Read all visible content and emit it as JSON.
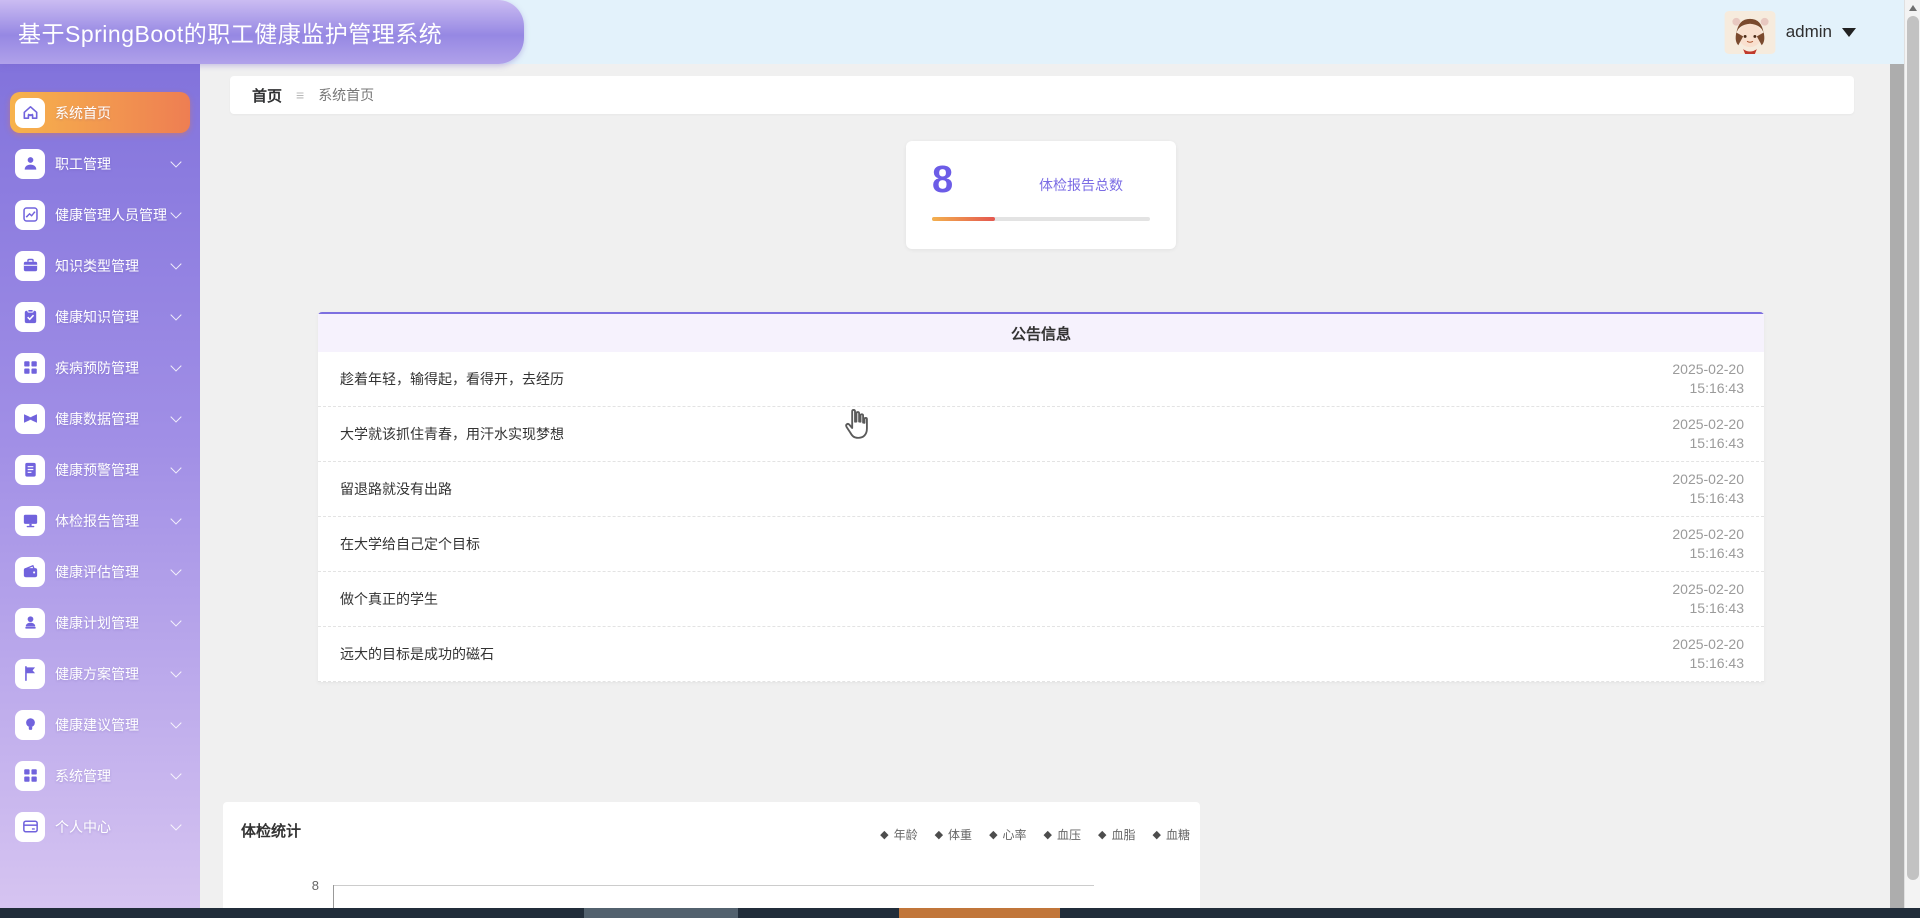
{
  "header": {
    "title": "基于SpringBoot的职工健康监护管理系统",
    "username": "admin"
  },
  "sidebar": {
    "items": [
      {
        "label": "系统首页",
        "icon": "home",
        "active": true
      },
      {
        "label": "职工管理",
        "icon": "worker",
        "active": false
      },
      {
        "label": "健康管理人员管理",
        "icon": "chart",
        "active": false
      },
      {
        "label": "知识类型管理",
        "icon": "briefcase",
        "active": false
      },
      {
        "label": "健康知识管理",
        "icon": "clipboard-check",
        "active": false
      },
      {
        "label": "疾病预防管理",
        "icon": "grid",
        "active": false
      },
      {
        "label": "健康数据管理",
        "icon": "data",
        "active": false
      },
      {
        "label": "健康预警管理",
        "icon": "doc",
        "active": false
      },
      {
        "label": "体检报告管理",
        "icon": "monitor",
        "active": false
      },
      {
        "label": "健康评估管理",
        "icon": "wallet",
        "active": false
      },
      {
        "label": "健康计划管理",
        "icon": "person-plan",
        "active": false
      },
      {
        "label": "健康方案管理",
        "icon": "flag",
        "active": false
      },
      {
        "label": "健康建议管理",
        "icon": "bulb",
        "active": false
      },
      {
        "label": "系统管理",
        "icon": "grid",
        "active": false
      },
      {
        "label": "个人中心",
        "icon": "card",
        "active": false
      }
    ]
  },
  "breadcrumb": {
    "root": "首页",
    "separator": "≡",
    "current": "系统首页"
  },
  "stat_card": {
    "value": "8",
    "label": "体检报告总数",
    "progress_percent": 29
  },
  "announcements": {
    "title": "公告信息",
    "items": [
      {
        "text": "趁着年轻，输得起，看得开，去经历",
        "date": "2025-02-20",
        "time": "15:16:43"
      },
      {
        "text": "大学就该抓住青春，用汗水实现梦想",
        "date": "2025-02-20",
        "time": "15:16:43"
      },
      {
        "text": "留退路就没有出路",
        "date": "2025-02-20",
        "time": "15:16:43"
      },
      {
        "text": "在大学给自己定个目标",
        "date": "2025-02-20",
        "time": "15:16:43"
      },
      {
        "text": "做个真正的学生",
        "date": "2025-02-20",
        "time": "15:16:43"
      },
      {
        "text": "远大的目标是成功的磁石",
        "date": "2025-02-20",
        "time": "15:16:43"
      }
    ]
  },
  "chart": {
    "title": "体检统计",
    "legend": [
      "年龄",
      "体重",
      "心率",
      "血压",
      "血脂",
      "血糖"
    ],
    "legend_marker": "◆",
    "y_tick": "8"
  },
  "chart_data": {
    "type": "line",
    "title": "体检统计",
    "legend_position": "top-right",
    "series": [
      {
        "name": "年龄",
        "values": []
      },
      {
        "name": "体重",
        "values": []
      },
      {
        "name": "心率",
        "values": []
      },
      {
        "name": "血压",
        "values": []
      },
      {
        "name": "血脂",
        "values": []
      },
      {
        "name": "血糖",
        "values": []
      }
    ],
    "visible_y_ticks": [
      8
    ]
  },
  "colors": {
    "accent_purple": "#7163dd",
    "header_banner": [
      "#cbbcf2",
      "#9688e3"
    ],
    "active_item_gradient": [
      "#f7b34c",
      "#ee7e52"
    ],
    "stat_value": "#6c5ce7",
    "progress_gradient": [
      "#f3b04e",
      "#e4574f"
    ],
    "panel_top_border": "#7d6fe0"
  }
}
